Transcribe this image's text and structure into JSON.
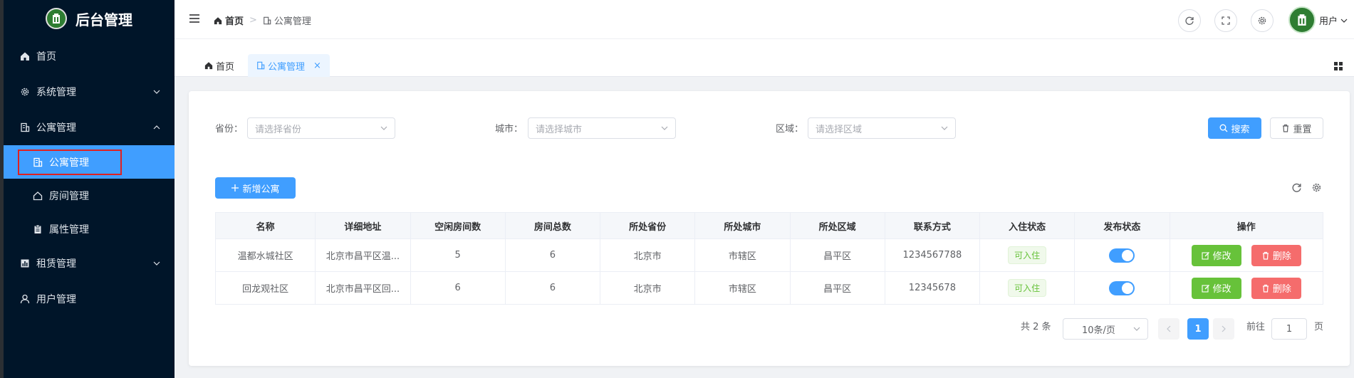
{
  "app": {
    "title": "后台管理"
  },
  "sidebar": {
    "items": [
      {
        "label": "首页",
        "icon": "home-icon"
      },
      {
        "label": "系统管理",
        "icon": "gear-icon"
      },
      {
        "label": "公寓管理",
        "icon": "building-icon"
      },
      {
        "label": "公寓管理",
        "icon": "building-icon",
        "sub": true,
        "active": true
      },
      {
        "label": "房间管理",
        "icon": "house-icon",
        "sub": true
      },
      {
        "label": "属性管理",
        "icon": "clipboard-icon",
        "sub": true
      },
      {
        "label": "租赁管理",
        "icon": "chart-icon"
      },
      {
        "label": "用户管理",
        "icon": "user-icon"
      }
    ]
  },
  "header": {
    "breadcrumb": [
      "首页",
      "公寓管理"
    ],
    "user": "用户"
  },
  "tabs": [
    {
      "label": "首页"
    },
    {
      "label": "公寓管理",
      "active": true,
      "close": "×"
    }
  ],
  "filters": {
    "province": {
      "label": "省份：",
      "placeholder": "请选择省份"
    },
    "city": {
      "label": "城市：",
      "placeholder": "请选择城市"
    },
    "district": {
      "label": "区域：",
      "placeholder": "请选择区域"
    },
    "search": "搜索",
    "reset": "重置"
  },
  "toolbar": {
    "add": "新增公寓"
  },
  "table": {
    "columns": [
      "名称",
      "详细地址",
      "空闲房间数",
      "房间总数",
      "所处省份",
      "所处城市",
      "所处区域",
      "联系方式",
      "入住状态",
      "发布状态",
      "操作"
    ],
    "rows": [
      {
        "name": "温都水城社区",
        "address": "北京市昌平区温...",
        "free": "5",
        "total": "6",
        "province": "北京市",
        "city": "市辖区",
        "district": "昌平区",
        "phone": "1234567788",
        "status": "可入住",
        "published": true
      },
      {
        "name": "回龙观社区",
        "address": "北京市昌平区回...",
        "free": "6",
        "total": "6",
        "province": "北京市",
        "city": "市辖区",
        "district": "昌平区",
        "phone": "12345678",
        "status": "可入住",
        "published": true
      }
    ],
    "edit": "修改",
    "delete": "删除"
  },
  "pagination": {
    "total": "共 2 条",
    "page_size": "10条/页",
    "current": "1",
    "goto": "前往",
    "goto_value": "1",
    "page_unit": "页"
  },
  "colors": {
    "primary": "#409eff",
    "sidebar": "#001529",
    "success": "#67c23a",
    "danger": "#f56c6c"
  }
}
